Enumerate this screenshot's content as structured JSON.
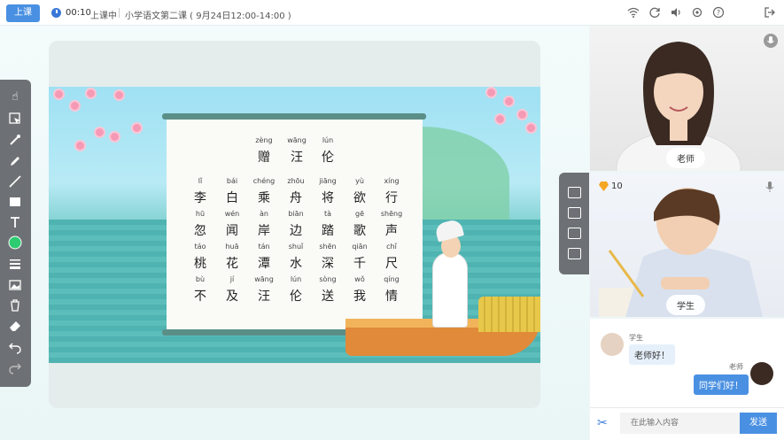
{
  "topbar": {
    "start_button": "上课",
    "timer": "00:10",
    "status": "上课中",
    "lesson_title": "小学语文第二课 ( 9月24日12:00-14:00 )",
    "icons": [
      "wifi-icon",
      "refresh-icon",
      "volume-icon",
      "settings-icon",
      "help-icon",
      "exit-icon"
    ]
  },
  "poem": {
    "title_pinyin": [
      "zèng",
      "wāng",
      "lún"
    ],
    "title_chars": [
      "赠",
      "汪",
      "伦"
    ],
    "lines": [
      {
        "pinyin": [
          "lǐ",
          "bái",
          "chéng",
          "zhōu",
          "jiāng",
          "yù",
          "xíng"
        ],
        "chars": [
          "李",
          "白",
          "乘",
          "舟",
          "将",
          "欲",
          "行"
        ]
      },
      {
        "pinyin": [
          "hū",
          "wén",
          "àn",
          "biān",
          "tà",
          "gē",
          "shēng"
        ],
        "chars": [
          "忽",
          "闻",
          "岸",
          "边",
          "踏",
          "歌",
          "声"
        ]
      },
      {
        "pinyin": [
          "táo",
          "huā",
          "tán",
          "shuǐ",
          "shēn",
          "qiān",
          "chǐ"
        ],
        "chars": [
          "桃",
          "花",
          "潭",
          "水",
          "深",
          "千",
          "尺"
        ]
      },
      {
        "pinyin": [
          "bù",
          "jí",
          "wāng",
          "lún",
          "sòng",
          "wǒ",
          "qíng"
        ],
        "chars": [
          "不",
          "及",
          "汪",
          "伦",
          "送",
          "我",
          "情"
        ]
      }
    ]
  },
  "toolbar": {
    "tools": [
      "pointer-icon",
      "select-icon",
      "laser-icon",
      "pen-icon",
      "line-icon",
      "rectangle-icon",
      "text-icon",
      "color-icon",
      "stroke-width-icon",
      "image-icon",
      "delete-icon",
      "eraser-icon",
      "undo-icon",
      "redo-icon"
    ],
    "color_accent": "#2ecc71"
  },
  "side_tools": [
    "add-page-icon",
    "folder-icon",
    "folder-settings-icon",
    "screen-share-icon"
  ],
  "teacher_video": {
    "label": "老师"
  },
  "student_video": {
    "label": "学生",
    "points": "10"
  },
  "chat": {
    "messages": [
      {
        "sender": "学生",
        "text": "老师好！"
      },
      {
        "sender": "老师",
        "text": "同学们好！"
      }
    ],
    "input_placeholder": "在此输入内容",
    "send_label": "发送"
  },
  "colors": {
    "accent": "#4a90e2",
    "toolbar": "#6d7175"
  }
}
